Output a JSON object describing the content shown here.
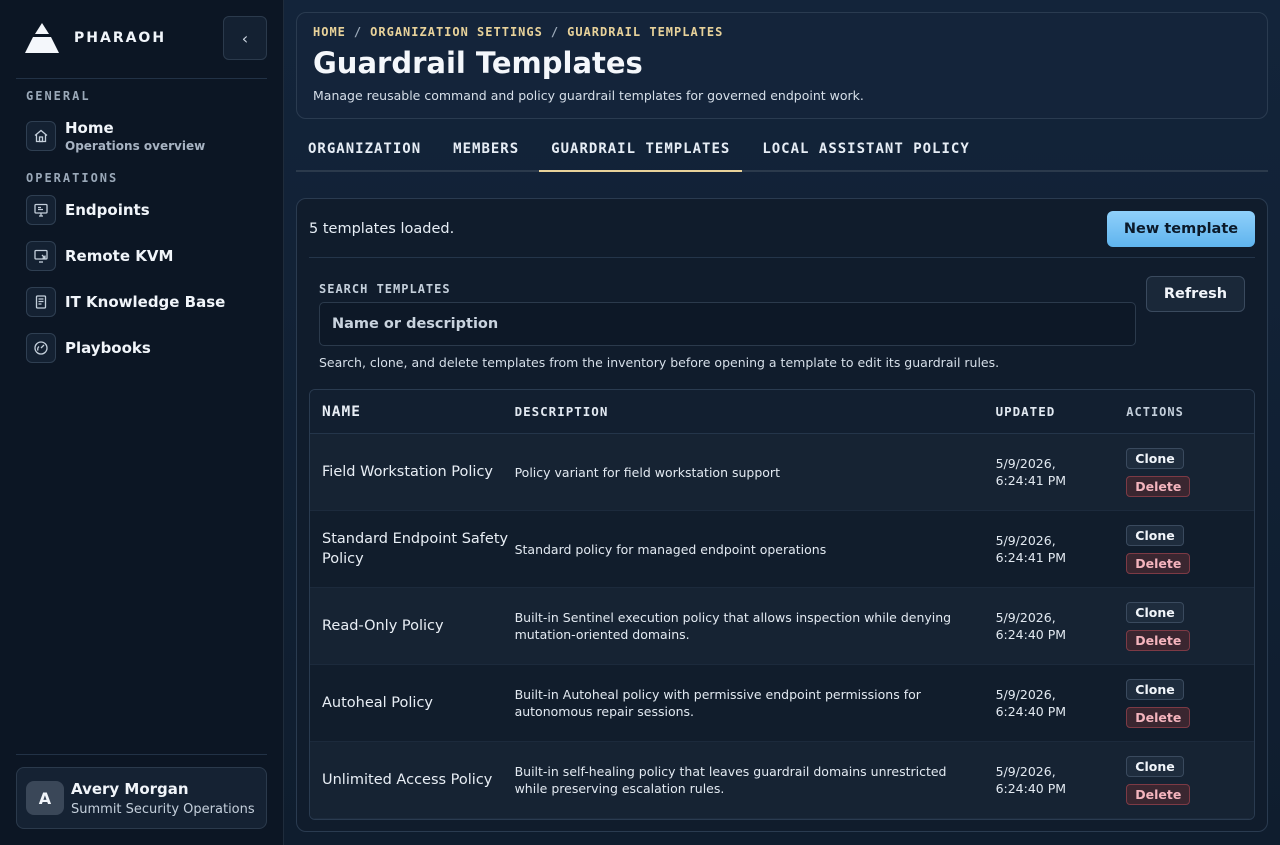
{
  "sidebar": {
    "brand": "PHARAOH",
    "sections": {
      "general": "GENERAL",
      "operations": "OPERATIONS"
    },
    "items": [
      {
        "label": "Home",
        "sub": "Operations overview",
        "icon": "home-icon"
      },
      {
        "label": "Endpoints",
        "icon": "monitor-icon"
      },
      {
        "label": "Remote KVM",
        "icon": "remote-screen-icon"
      },
      {
        "label": "IT Knowledge Base",
        "icon": "book-icon"
      },
      {
        "label": "Playbooks",
        "icon": "gauge-icon"
      }
    ],
    "user": {
      "initial": "A",
      "name": "Avery Morgan",
      "org": "Summit Security Operations"
    }
  },
  "header": {
    "breadcrumb": [
      "HOME",
      "ORGANIZATION SETTINGS",
      "GUARDRAIL TEMPLATES"
    ],
    "title": "Guardrail Templates",
    "subtitle": "Manage reusable command and policy guardrail templates for governed endpoint work."
  },
  "tabs": [
    {
      "label": "ORGANIZATION"
    },
    {
      "label": "MEMBERS"
    },
    {
      "label": "GUARDRAIL TEMPLATES",
      "active": true
    },
    {
      "label": "LOCAL ASSISTANT POLICY"
    }
  ],
  "panel": {
    "status": "5 templates loaded.",
    "new_button": "New template",
    "search_label": "SEARCH TEMPLATES",
    "search_placeholder": "Name or description",
    "refresh_button": "Refresh",
    "hint": "Search, clone, and delete templates from the inventory before opening a template to edit its guardrail rules."
  },
  "table": {
    "columns": [
      "NAME",
      "DESCRIPTION",
      "UPDATED",
      "ACTIONS"
    ],
    "clone_label": "Clone",
    "delete_label": "Delete",
    "rows": [
      {
        "name": "Field Workstation Policy",
        "description": "Policy variant for field workstation support",
        "updated_date": "5/9/2026,",
        "updated_time": "6:24:41 PM"
      },
      {
        "name": "Standard Endpoint Safety Policy",
        "description": "Standard policy for managed endpoint operations",
        "updated_date": "5/9/2026,",
        "updated_time": "6:24:41 PM"
      },
      {
        "name": "Read-Only Policy",
        "description": "Built-in Sentinel execution policy that allows inspection while denying mutation-oriented domains.",
        "updated_date": "5/9/2026,",
        "updated_time": "6:24:40 PM"
      },
      {
        "name": "Autoheal Policy",
        "description": "Built-in Autoheal policy with permissive endpoint permissions for autonomous repair sessions.",
        "updated_date": "5/9/2026,",
        "updated_time": "6:24:40 PM"
      },
      {
        "name": "Unlimited Access Policy",
        "description": "Built-in self-healing policy that leaves guardrail domains unrestricted while preserving escalation rules.",
        "updated_date": "5/9/2026,",
        "updated_time": "6:24:40 PM"
      }
    ]
  },
  "colors": {
    "accent": "#e8d29a",
    "primary_button": "#7cc4f5",
    "danger": "#f4b4bd"
  }
}
